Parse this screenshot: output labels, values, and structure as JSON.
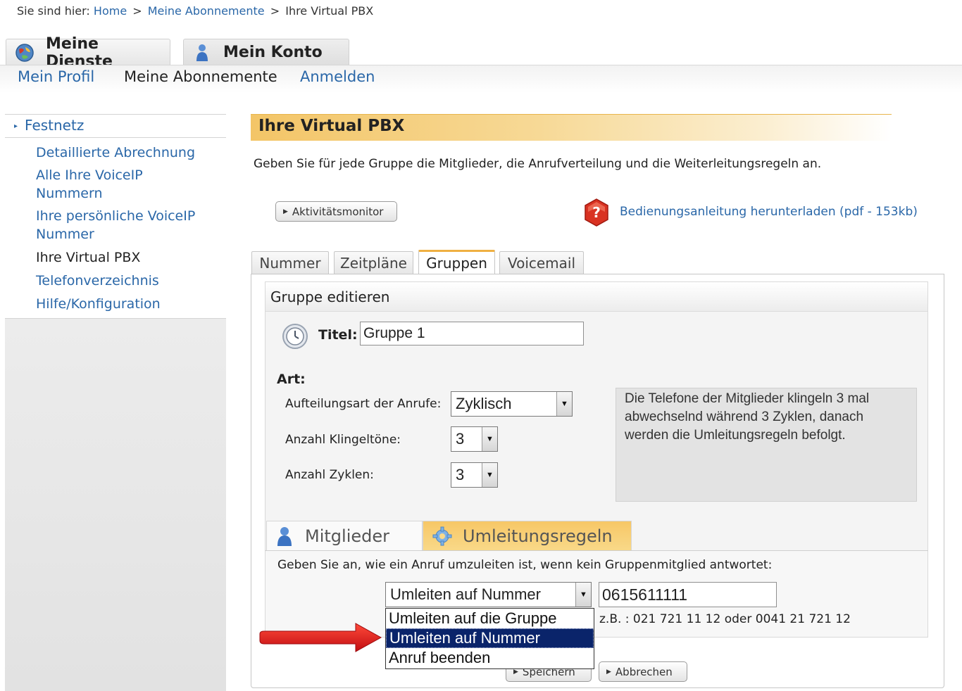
{
  "breadcrumb": {
    "prefix": "Sie sind hier:",
    "items": [
      "Home",
      "Meine Abonnemente",
      "Ihre Virtual PBX"
    ],
    "separator": ">"
  },
  "main_tabs": [
    {
      "label": "Meine Dienste",
      "icon": "globe-icon"
    },
    {
      "label": "Mein Konto",
      "icon": "user-icon"
    }
  ],
  "sub_nav": [
    "Mein Profil",
    "Meine Abonnemente",
    "Anmelden"
  ],
  "sidebar": {
    "section": "Festnetz",
    "items": [
      "Detaillierte Abrechnung",
      "Alle Ihre VoiceIP Nummern",
      "Ihre persönliche VoiceIP Nummer",
      "Ihre Virtual PBX",
      "Telefonverzeichnis",
      "Hilfe/Konfiguration"
    ],
    "active_index": 3
  },
  "page": {
    "title": "Ihre Virtual PBX",
    "intro": "Geben Sie für jede Gruppe die Mitglieder, die Anrufverteilung und die Weiterleitungsregeln an.",
    "activity_button": "Aktivitätsmonitor",
    "manual_link": "Bedienungsanleitung herunterladen (pdf - 153kb)"
  },
  "tabs": [
    "Nummer",
    "Zeitpläne",
    "Gruppen",
    "Voicemail"
  ],
  "active_tab": "Gruppen",
  "group_edit": {
    "heading": "Gruppe editieren",
    "title_label": "Titel:",
    "title_value": "Gruppe 1",
    "art_label": "Art:",
    "distribution_label": "Aufteilungsart der Anrufe:",
    "distribution_value": "Zyklisch",
    "rings_label": "Anzahl Klingeltöne:",
    "rings_value": "3",
    "cycles_label": "Anzahl Zyklen:",
    "cycles_value": "3",
    "info_text": "Die Telefone der Mitglieder klingeln 3 mal abwechselnd während 3 Zyklen, danach werden die Umleitungsregeln befolgt."
  },
  "sub_tabs": [
    "Mitglieder",
    "Umleitungsregeln"
  ],
  "redirect": {
    "intro": "Geben Sie an, wie ein Anruf umzuleiten ist, wenn kein Gruppenmitglied antwortet:",
    "select_value": "Umleiten auf Nummer",
    "number_value": "0615611111",
    "example": "z.B. : 021 721 11 12 oder 0041 21 721 12",
    "options": [
      "Umleiten auf die Gruppe",
      "Umleiten auf Nummer",
      "Anruf beenden"
    ],
    "highlighted_option_index": 1
  },
  "buttons": {
    "save": "Speichern",
    "cancel": "Abbrechen"
  },
  "colors": {
    "link": "#2a67a8",
    "accent": "#efb042",
    "selection": "#0a246a",
    "arrow": "#e0161b"
  }
}
